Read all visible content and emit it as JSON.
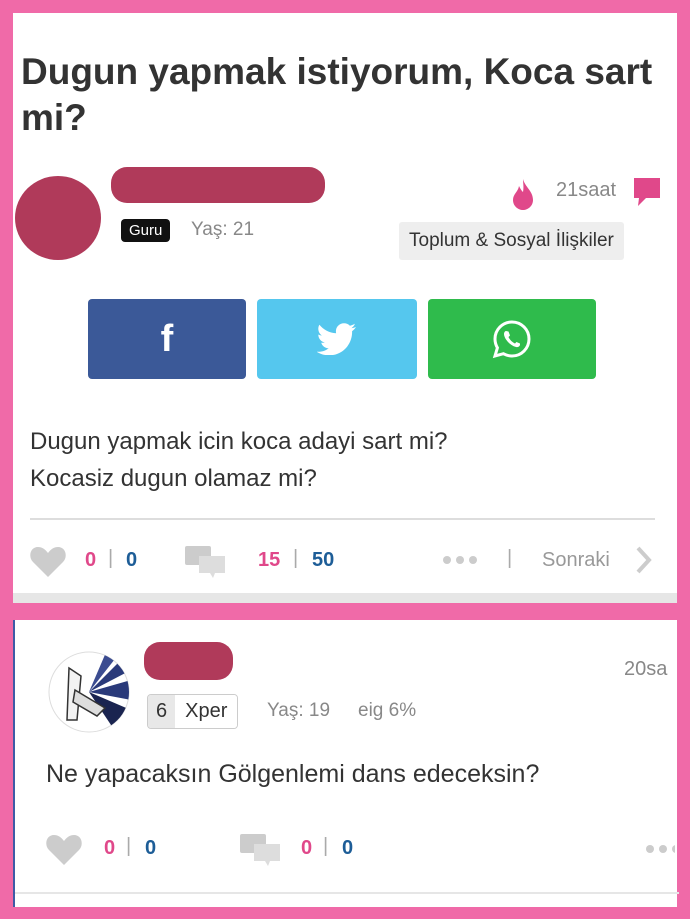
{
  "question": {
    "title": "Dugun yapmak istiyorum, Koca sart mi?",
    "badge": "Guru",
    "age": "Yaş: 21",
    "time": "21saat",
    "category": "Toplum & Sosyal İlişkiler",
    "body_line1": "Dugun yapmak icin koca adayi sart mi?",
    "body_line2": "Kocasiz dugun olamaz mi?",
    "likes_a": "0",
    "likes_b": "0",
    "comments_a": "15",
    "comments_b": "50",
    "next_label": "Sonraki",
    "share_facebook": "f"
  },
  "answer": {
    "level": "6",
    "level_label": "Xper",
    "age": "Yaş: 19",
    "eig": "eig 6%",
    "time": "20sa",
    "text": "Ne yapacaksın Gölgenlemi dans edeceksin?",
    "likes_a": "0",
    "likes_b": "0",
    "comments_a": "0",
    "comments_b": "0"
  },
  "colors": {
    "frame": "#f06aa8",
    "facebook": "#3b5998",
    "twitter": "#55c7ee",
    "whatsapp": "#2fbb4c",
    "pink": "#e0488a",
    "blue": "#1d5d97"
  }
}
